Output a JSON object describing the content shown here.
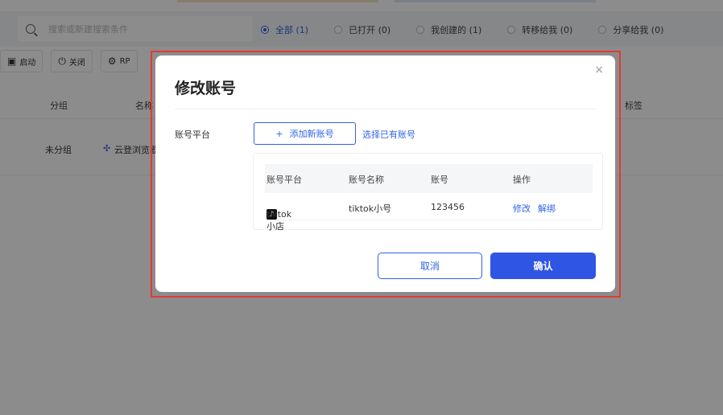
{
  "background": {
    "search_placeholder": "搜索或新建搜索条件",
    "filters": [
      {
        "label": "全部 (1)",
        "selected": true
      },
      {
        "label": "已打开 (0)",
        "selected": false
      },
      {
        "label": "我创建的 (1)",
        "selected": false
      },
      {
        "label": "转移给我 (0)",
        "selected": false
      },
      {
        "label": "分享给我 (0)",
        "selected": false
      }
    ],
    "toolbar": {
      "start_label": "启动",
      "close_label": "关闭",
      "third_label": "RP"
    },
    "table_headers": {
      "group": "分组",
      "name": "名称",
      "tag": "标签"
    },
    "row": {
      "group": "未分组",
      "name": "云登浏览器"
    }
  },
  "modal": {
    "title": "修改账号",
    "close_glyph": "×",
    "field_label": "账号平台",
    "add_button_label": "添加新账号",
    "add_button_icon": "+",
    "select_existing_label": "选择已有账号",
    "table": {
      "headers": [
        "账号平台",
        "账号名称",
        "账号",
        "操作"
      ],
      "rows": [
        {
          "platform": "tiktok小店",
          "platform_icon": "tiktok-icon",
          "name": "tiktok小号",
          "account": "123456",
          "edit_label": "修改",
          "unbind_label": "解绑"
        }
      ]
    },
    "cancel_label": "取消",
    "confirm_label": "确认"
  },
  "colors": {
    "accent": "#2f64e6",
    "confirm_bg": "#2f55e4",
    "highlight_frame": "#e53935"
  }
}
